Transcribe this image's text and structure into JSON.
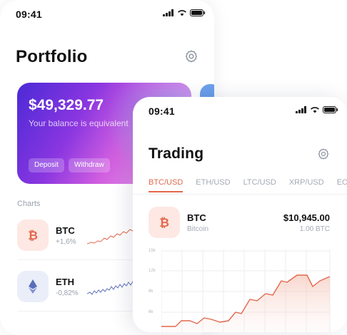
{
  "portfolio_screen": {
    "status_time": "09:41",
    "title": "Portfolio",
    "balance": "$49,329.77",
    "balance_caption": "Your balance is equivalent",
    "deposit_label": "Deposit",
    "withdraw_label": "Withdraw",
    "charts_label": "Charts",
    "coins": [
      {
        "symbol": "BTC",
        "change": "+1,6%",
        "icon": "bitcoin-icon",
        "color": "#e2674c"
      },
      {
        "symbol": "ETH",
        "change": "-0,82%",
        "icon": "ethereum-icon",
        "color": "#5a6fb8"
      }
    ]
  },
  "trading_screen": {
    "status_time": "09:41",
    "title": "Trading",
    "tabs": [
      "BTC/USD",
      "ETH/USD",
      "LTC/USD",
      "XRP/USD",
      "EOS"
    ],
    "active_tab": "BTC/USD",
    "coin": {
      "symbol": "BTC",
      "name": "Bitcoin",
      "price": "$10,945.00",
      "amount": "1.00 BTC"
    },
    "chart": {
      "y_labels": [
        "15k",
        "12k",
        "8k",
        "6k"
      ]
    }
  },
  "colors": {
    "accent": "#e2674c",
    "text_muted": "#9aa0ad"
  }
}
